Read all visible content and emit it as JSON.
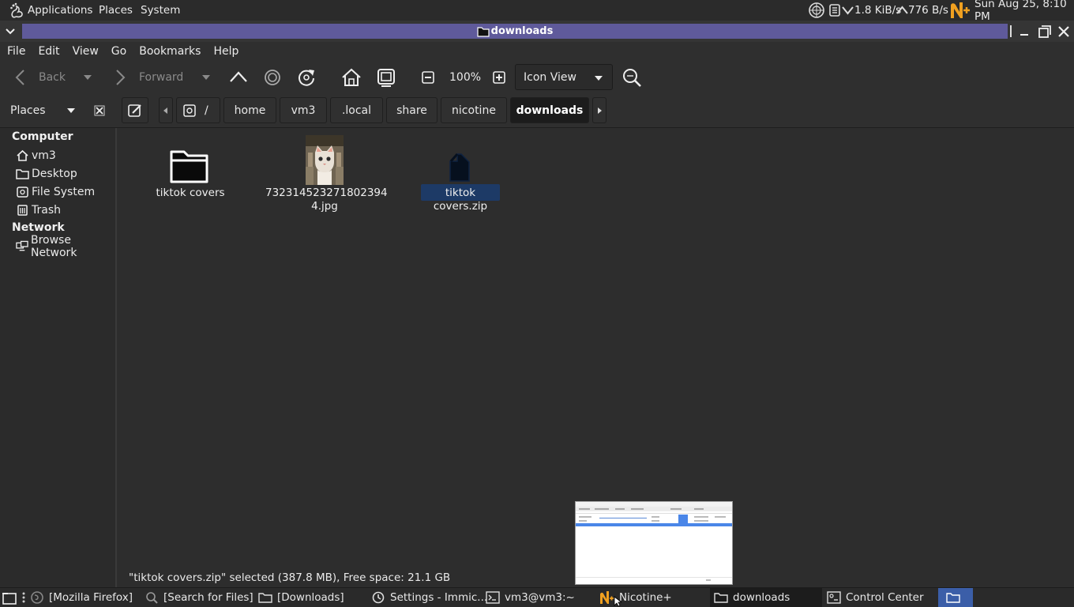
{
  "top_panel": {
    "apps_label": "Applications",
    "places_label": "Places",
    "system_label": "System",
    "net_down": "1.8 KiB/s",
    "net_up": "776 B/s",
    "clock": "Sun Aug 25,  8:10 PM"
  },
  "window": {
    "title": "downloads"
  },
  "menubar": {
    "items": [
      "File",
      "Edit",
      "View",
      "Go",
      "Bookmarks",
      "Help"
    ]
  },
  "toolbar": {
    "back_label": "Back",
    "forward_label": "Forward",
    "zoom_level": "100%",
    "view_mode": "Icon View"
  },
  "location": {
    "places_label": "Places",
    "root": "/",
    "crumbs": [
      "home",
      "vm3",
      ".local",
      "share",
      "nicotine",
      "downloads"
    ]
  },
  "sidebar": {
    "computer_heading": "Computer",
    "network_heading": "Network",
    "items": [
      "vm3",
      "Desktop",
      "File System",
      "Trash"
    ],
    "network_items": [
      "Browse Network"
    ]
  },
  "files": [
    {
      "name": "tiktok covers",
      "kind": "folder-icon"
    },
    {
      "name_line1": "732314523271802394",
      "name_line2": "4.jpg",
      "kind": "image-thumbnail"
    },
    {
      "name": "tiktok covers.zip",
      "kind": "archive-icon",
      "selected": true
    }
  ],
  "status": {
    "text": "\"tiktok covers.zip\" selected (387.8 MB), Free space: 21.1 GB"
  },
  "taskbar": {
    "items": [
      "[Mozilla Firefox]",
      "[Search for Files]",
      "[Downloads]",
      "Settings - Immic...",
      "vm3@vm3:~",
      "Nicotine+",
      "downloads",
      "Control Center"
    ]
  },
  "colors": {
    "title_strip": "#5f5a9b",
    "selection": "#1d3a66",
    "nicotine_orange": "#f0a020",
    "background": "#2d2d2d"
  }
}
